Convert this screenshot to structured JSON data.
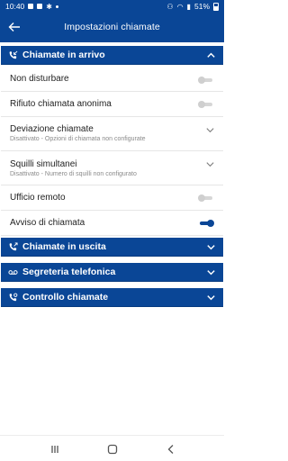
{
  "status_bar": {
    "time": "10:40",
    "battery": "51%"
  },
  "header": {
    "title": "Impostazioni chiamate"
  },
  "sections": {
    "incoming": {
      "label": "Chiamate in arrivo"
    },
    "outgoing": {
      "label": "Chiamate in uscita"
    },
    "voicemail": {
      "label": "Segreteria telefonica"
    },
    "call_control": {
      "label": "Controllo chiamate"
    }
  },
  "settings": {
    "do_not_disturb": {
      "label": "Non disturbare",
      "enabled": false
    },
    "anonymous_rejection": {
      "label": "Rifiuto chiamata anonima",
      "enabled": false
    },
    "call_forwarding": {
      "label": "Deviazione chiamate",
      "subtitle": "Disattivato - Opzioni di chiamata non configurate"
    },
    "simultaneous_ring": {
      "label": "Squilli simultanei",
      "subtitle": "Disattivato - Numero di squilli non configurato"
    },
    "remote_office": {
      "label": "Ufficio remoto",
      "enabled": false
    },
    "call_waiting": {
      "label": "Avviso di chiamata",
      "enabled": true
    }
  },
  "colors": {
    "primary": "#0a4696",
    "toggle_off": "#d0d0d0",
    "subtitle": "#8a8a8a"
  },
  "icons": {
    "back": "arrow-left-icon",
    "incoming": "incoming-call-icon",
    "outgoing": "outgoing-call-icon",
    "voicemail": "voicemail-icon",
    "control": "call-control-icon"
  }
}
